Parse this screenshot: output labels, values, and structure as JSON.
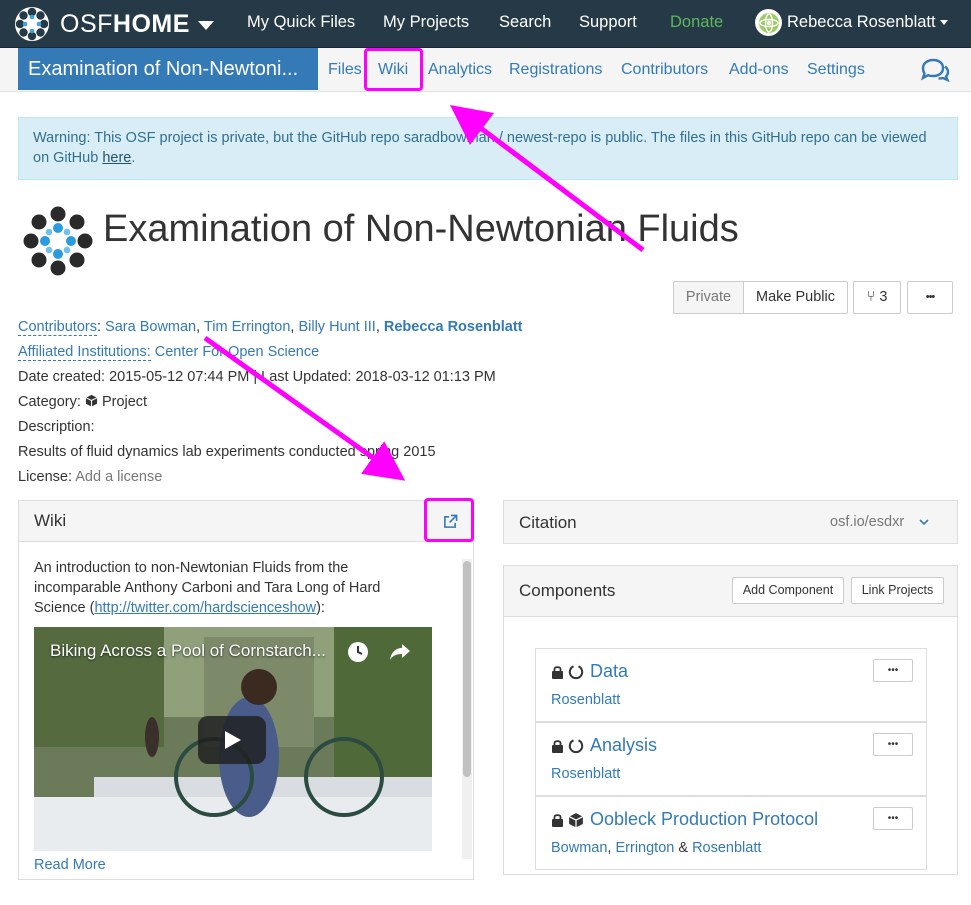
{
  "topnav": {
    "brand_light": "OSF",
    "brand_bold": "HOME",
    "items": [
      "My Quick Files",
      "My Projects",
      "Search",
      "Support",
      "Donate"
    ],
    "user_name": "Rebecca Rosenblatt"
  },
  "subnav": {
    "project_title": "Examination of Non-Newtoni...",
    "tabs": [
      "Files",
      "Wiki",
      "Analytics",
      "Registrations",
      "Contributors",
      "Add-ons",
      "Settings"
    ]
  },
  "alert": {
    "text": "Warning: This OSF project is private, but the GitHub repo saradbowman / newest-repo is public. The files in this GitHub repo can be viewed on GitHub ",
    "link": "here",
    "end": "."
  },
  "project": {
    "title": "Examination of Non-Newtonian Fluids",
    "buttons": {
      "private": "Private",
      "make_public": "Make Public",
      "forks": "3",
      "more": "•••"
    }
  },
  "meta": {
    "contributors_label": "Contributors",
    "contributors": [
      "Sara Bowman",
      "Tim Errington",
      "Billy Hunt III",
      "Rebecca Rosenblatt"
    ],
    "affiliated_label": "Affiliated Institutions:",
    "affiliated": "Center For Open Science",
    "dates": "Date created: 2015-05-12 07:44 PM | Last Updated: 2018-03-12 01:13 PM",
    "category_label": "Category:",
    "category": "Project",
    "description_label": "Description:",
    "description": "Results of fluid dynamics lab experiments conducted spring 2015",
    "license_label": "License:",
    "license": "Add a license"
  },
  "wiki": {
    "title": "Wiki",
    "intro_1": "An introduction to non-Newtonian Fluids from the incomparable Anthony Carboni and Tara Long of Hard Science (",
    "link": "http://twitter.com/hardscienceshow",
    "intro_2": "):",
    "video_title": "Biking Across a Pool of Cornstarch...",
    "read_more": "Read More"
  },
  "citation": {
    "title": "Citation",
    "url": "osf.io/esdxr"
  },
  "components": {
    "title": "Components",
    "add": "Add Component",
    "link": "Link Projects",
    "items": [
      {
        "title": "Data",
        "authors": [
          "Rosenblatt"
        ],
        "icon": "circle-notch-icon"
      },
      {
        "title": "Analysis",
        "authors": [
          "Rosenblatt"
        ],
        "icon": "circle-notch-icon"
      },
      {
        "title": "Oobleck Production Protocol",
        "authors": [
          "Bowman",
          "Errington",
          "Rosenblatt"
        ],
        "icon": "cube-icon"
      }
    ],
    "more": "•••"
  },
  "colors": {
    "navbar": "#263947",
    "accent": "#337ab7",
    "highlight": "#ff00ff"
  }
}
